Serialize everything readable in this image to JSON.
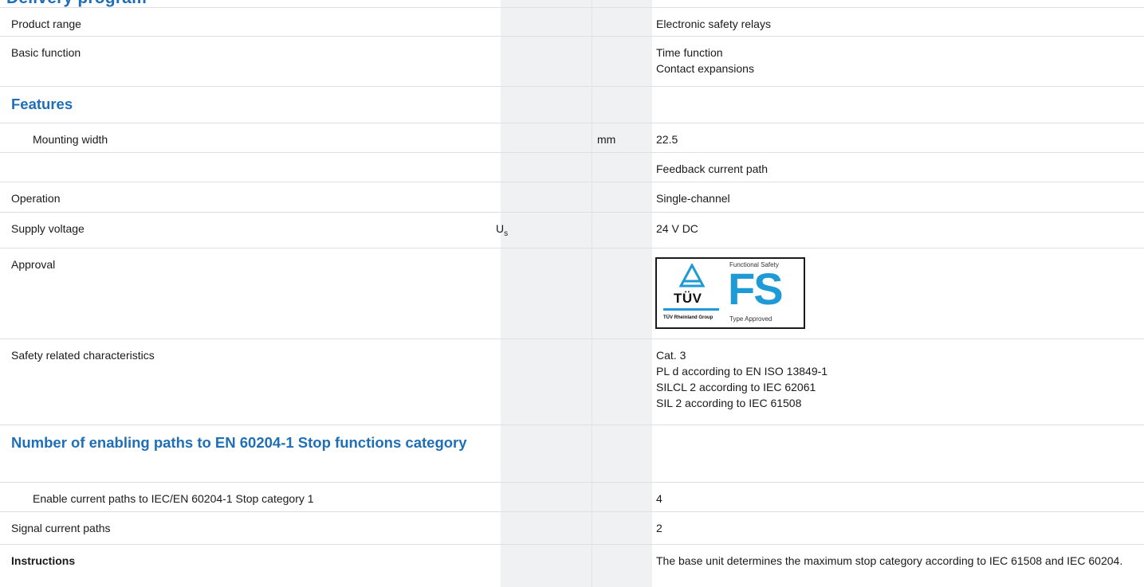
{
  "section_title_cut": "Delivery program",
  "rows": {
    "product_range": {
      "label": "Product range",
      "value": "Electronic safety relays"
    },
    "basic_function": {
      "label": "Basic function",
      "values": [
        "Time function",
        "Contact expansions"
      ]
    },
    "features_heading": "Features",
    "mounting_width": {
      "label": "Mounting width",
      "unit": "mm",
      "value": "22.5"
    },
    "feedback": {
      "value": "Feedback current path"
    },
    "operation": {
      "label": "Operation",
      "value": "Single-channel"
    },
    "supply_voltage": {
      "label": "Supply voltage",
      "symbol": "U",
      "symbol_sub": "s",
      "value": "24 V DC"
    },
    "approval": {
      "label": "Approval",
      "badge": {
        "title": "Functional Safety",
        "fs": "FS",
        "subtitle": "Type Approved",
        "tuv": "TÜV",
        "group": "TÜV Rheinland Group",
        "accent": "#1e9ad6",
        "icon": "tuv-triangle-icon"
      }
    },
    "safety": {
      "label": "Safety related characteristics",
      "values": [
        "Cat. 3",
        "PL d according to EN ISO 13849-1",
        "SILCL 2 according to IEC 62061",
        "SIL 2 according to IEC 61508"
      ]
    },
    "enabling_heading": "Number of enabling paths to EN 60204-1 Stop functions category",
    "enable_paths": {
      "label": "Enable current paths to IEC/EN 60204-1 Stop category 1",
      "value": "4"
    },
    "signal_paths": {
      "label": "Signal current paths",
      "value": "2"
    },
    "instructions": {
      "label": "Instructions",
      "value": "The base unit determines the maximum stop category according to IEC 61508 and IEC 60204."
    }
  },
  "colors": {
    "heading": "#1f6fb8",
    "grey_column": "#f0f1f3",
    "divider": "#dcdfe3"
  }
}
